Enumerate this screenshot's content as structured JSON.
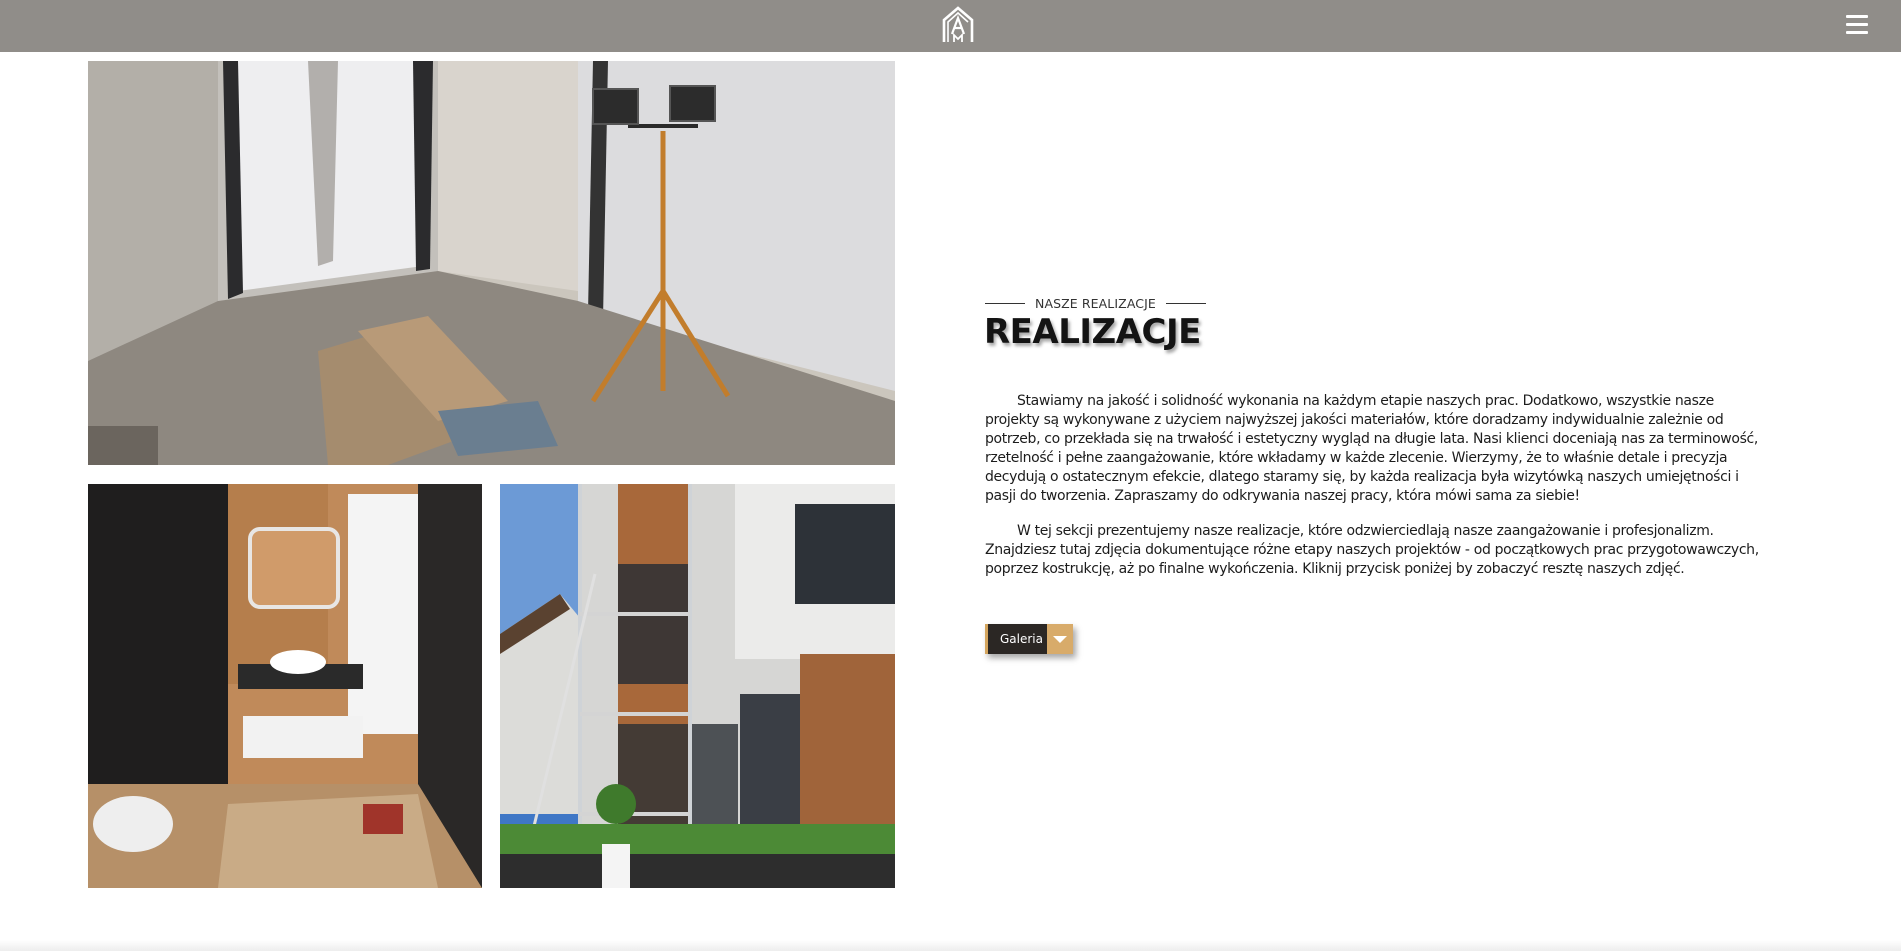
{
  "header": {
    "logo_icon": "house-am-logo-icon",
    "menu_icon": "hamburger-menu-icon",
    "bar_color": "#908d89"
  },
  "gallery_images": [
    {
      "name": "unfinished-room-with-work-light"
    },
    {
      "name": "bathroom-in-progress"
    },
    {
      "name": "house-facade-with-scaffolding"
    }
  ],
  "section": {
    "eyebrow": "NASZE REALIZACJE",
    "title": "REALIZACJE",
    "paragraph1": "Stawiamy na jakość i solidność wykonania na każdym etapie naszych prac. Dodatkowo, wszystkie nasze projekty są wykonywane z użyciem najwyższej jakości materiałów, które doradzamy indywidualnie zależnie od potrzeb, co przekłada się na trwałość i estetyczny wygląd na długie lata. Nasi klienci doceniają nas za terminowość, rzetelność i pełne zaangażowanie, które wkładamy w każde zlecenie. Wierzymy, że to właśnie detale i precyzja decydują o ostatecznym efekcie, dlatego staramy się, by każda realizacja była wizytówką naszych umiejętności i pasji do tworzenia. Zapraszamy do odkrywania naszej pracy, która mówi sama za siebie!",
    "paragraph2": "W tej sekcji prezentujemy nasze realizacje, które odzwierciedlają nasze zaangażowanie i profesjonalizm. Znajdziesz tutaj zdjęcia dokumentujące różne etapy naszych projektów - od początkowych prac przygotowawczych, poprzez kostrukcję, aż po finalne wykończenia. Kliknij przycisk poniżej by zobaczyć resztę naszych zdjęć.",
    "button_label": "Galeria",
    "button_icon": "chevron-down-icon",
    "accent_color": "#d8ab6a"
  }
}
